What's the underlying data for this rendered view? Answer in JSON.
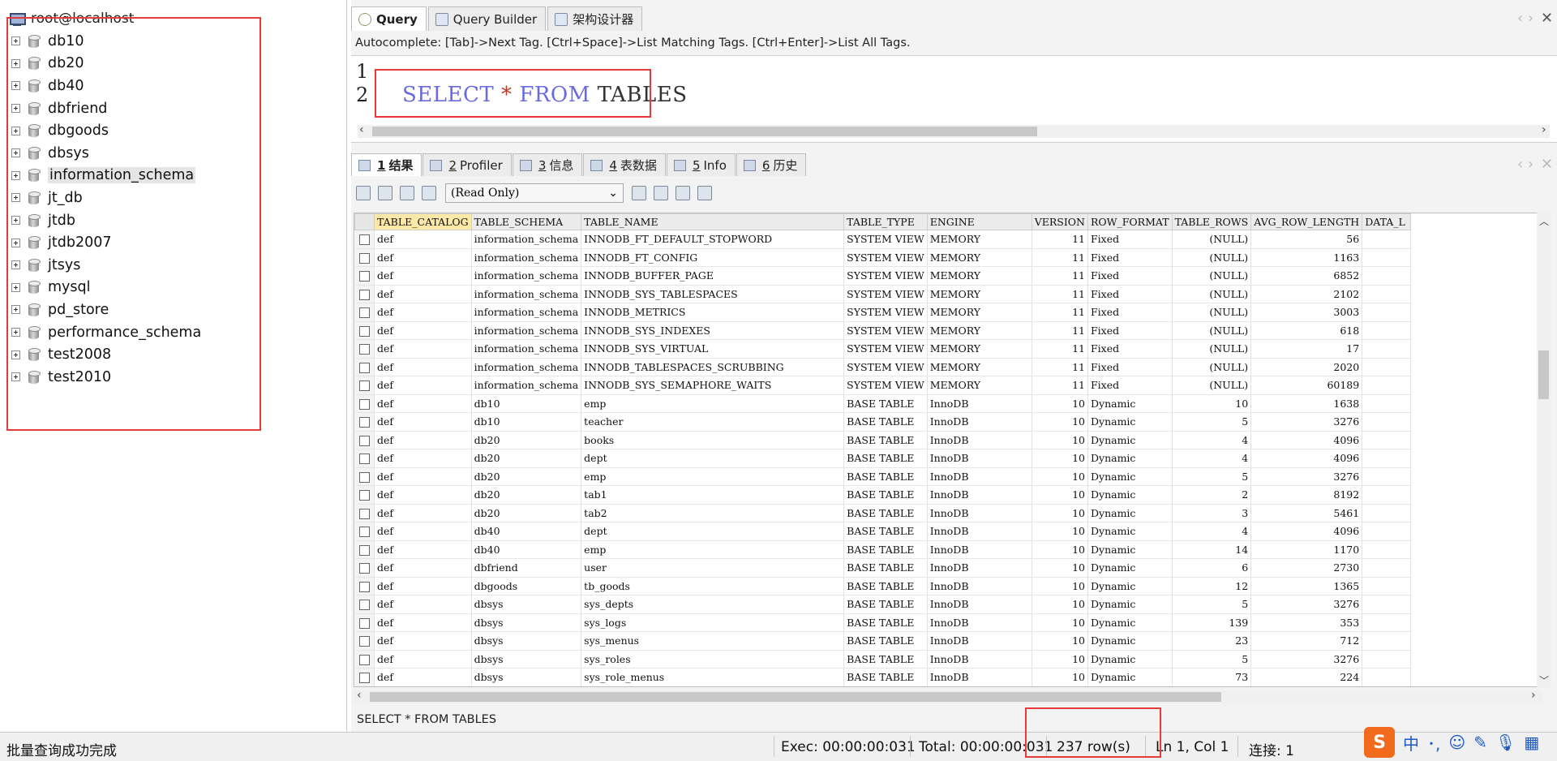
{
  "tree": {
    "host": "root@localhost",
    "items": [
      {
        "label": "db10"
      },
      {
        "label": "db20"
      },
      {
        "label": "db40"
      },
      {
        "label": "dbfriend"
      },
      {
        "label": "dbgoods"
      },
      {
        "label": "dbsys"
      },
      {
        "label": "information_schema",
        "selected": true
      },
      {
        "label": "jt_db"
      },
      {
        "label": "jtdb"
      },
      {
        "label": "jtdb2007"
      },
      {
        "label": "jtsys"
      },
      {
        "label": "mysql"
      },
      {
        "label": "pd_store"
      },
      {
        "label": "performance_schema"
      },
      {
        "label": "test2008"
      },
      {
        "label": "test2010"
      }
    ]
  },
  "editor_tabs": [
    {
      "label": "Query",
      "active": true,
      "icon": "query-icon"
    },
    {
      "label": "Query Builder",
      "active": false,
      "icon": "query-builder-icon"
    },
    {
      "label": "架构设计器",
      "active": false,
      "icon": "schema-designer-icon"
    }
  ],
  "autocomplete_hint": "Autocomplete: [Tab]->Next Tag. [Ctrl+Space]->List Matching Tags. [Ctrl+Enter]->List All Tags.",
  "editor": {
    "line_numbers": [
      "1",
      "2"
    ],
    "sql": {
      "kw1": "SELECT",
      "star": "*",
      "kw2": "FROM",
      "table": "TABLES"
    }
  },
  "result_tabs": [
    {
      "num": "1",
      "label": "结果",
      "active": true,
      "icon": "result-icon"
    },
    {
      "num": "2",
      "label": "Profiler",
      "active": false,
      "icon": "profiler-icon"
    },
    {
      "num": "3",
      "label": "信息",
      "active": false,
      "icon": "info-icon"
    },
    {
      "num": "4",
      "label": "表数据",
      "active": false,
      "icon": "table-data-icon"
    },
    {
      "num": "5",
      "label": "Info",
      "active": false,
      "icon": "info-chart-icon"
    },
    {
      "num": "6",
      "label": "历史",
      "active": false,
      "icon": "history-icon"
    }
  ],
  "result_toolbar": {
    "mode_select": "(Read Only)"
  },
  "grid": {
    "columns": [
      "TABLE_CATALOG",
      "TABLE_SCHEMA",
      "TABLE_NAME",
      "TABLE_TYPE",
      "ENGINE",
      "VERSION",
      "ROW_FORMAT",
      "TABLE_ROWS",
      "AVG_ROW_LENGTH",
      "DATA_L"
    ],
    "rows": [
      [
        "def",
        "information_schema",
        "INNODB_FT_DEFAULT_STOPWORD",
        "SYSTEM VIEW",
        "MEMORY",
        "11",
        "Fixed",
        "(NULL)",
        "56",
        ""
      ],
      [
        "def",
        "information_schema",
        "INNODB_FT_CONFIG",
        "SYSTEM VIEW",
        "MEMORY",
        "11",
        "Fixed",
        "(NULL)",
        "1163",
        ""
      ],
      [
        "def",
        "information_schema",
        "INNODB_BUFFER_PAGE",
        "SYSTEM VIEW",
        "MEMORY",
        "11",
        "Fixed",
        "(NULL)",
        "6852",
        ""
      ],
      [
        "def",
        "information_schema",
        "INNODB_SYS_TABLESPACES",
        "SYSTEM VIEW",
        "MEMORY",
        "11",
        "Fixed",
        "(NULL)",
        "2102",
        ""
      ],
      [
        "def",
        "information_schema",
        "INNODB_METRICS",
        "SYSTEM VIEW",
        "MEMORY",
        "11",
        "Fixed",
        "(NULL)",
        "3003",
        ""
      ],
      [
        "def",
        "information_schema",
        "INNODB_SYS_INDEXES",
        "SYSTEM VIEW",
        "MEMORY",
        "11",
        "Fixed",
        "(NULL)",
        "618",
        ""
      ],
      [
        "def",
        "information_schema",
        "INNODB_SYS_VIRTUAL",
        "SYSTEM VIEW",
        "MEMORY",
        "11",
        "Fixed",
        "(NULL)",
        "17",
        ""
      ],
      [
        "def",
        "information_schema",
        "INNODB_TABLESPACES_SCRUBBING",
        "SYSTEM VIEW",
        "MEMORY",
        "11",
        "Fixed",
        "(NULL)",
        "2020",
        ""
      ],
      [
        "def",
        "information_schema",
        "INNODB_SYS_SEMAPHORE_WAITS",
        "SYSTEM VIEW",
        "MEMORY",
        "11",
        "Fixed",
        "(NULL)",
        "60189",
        ""
      ],
      [
        "def",
        "db10",
        "emp",
        "BASE TABLE",
        "InnoDB",
        "10",
        "Dynamic",
        "10",
        "1638",
        ""
      ],
      [
        "def",
        "db10",
        "teacher",
        "BASE TABLE",
        "InnoDB",
        "10",
        "Dynamic",
        "5",
        "3276",
        ""
      ],
      [
        "def",
        "db20",
        "books",
        "BASE TABLE",
        "InnoDB",
        "10",
        "Dynamic",
        "4",
        "4096",
        ""
      ],
      [
        "def",
        "db20",
        "dept",
        "BASE TABLE",
        "InnoDB",
        "10",
        "Dynamic",
        "4",
        "4096",
        ""
      ],
      [
        "def",
        "db20",
        "emp",
        "BASE TABLE",
        "InnoDB",
        "10",
        "Dynamic",
        "5",
        "3276",
        ""
      ],
      [
        "def",
        "db20",
        "tab1",
        "BASE TABLE",
        "InnoDB",
        "10",
        "Dynamic",
        "2",
        "8192",
        ""
      ],
      [
        "def",
        "db20",
        "tab2",
        "BASE TABLE",
        "InnoDB",
        "10",
        "Dynamic",
        "3",
        "5461",
        ""
      ],
      [
        "def",
        "db40",
        "dept",
        "BASE TABLE",
        "InnoDB",
        "10",
        "Dynamic",
        "4",
        "4096",
        ""
      ],
      [
        "def",
        "db40",
        "emp",
        "BASE TABLE",
        "InnoDB",
        "10",
        "Dynamic",
        "14",
        "1170",
        ""
      ],
      [
        "def",
        "dbfriend",
        "user",
        "BASE TABLE",
        "InnoDB",
        "10",
        "Dynamic",
        "6",
        "2730",
        ""
      ],
      [
        "def",
        "dbgoods",
        "tb_goods",
        "BASE TABLE",
        "InnoDB",
        "10",
        "Dynamic",
        "12",
        "1365",
        ""
      ],
      [
        "def",
        "dbsys",
        "sys_depts",
        "BASE TABLE",
        "InnoDB",
        "10",
        "Dynamic",
        "5",
        "3276",
        ""
      ],
      [
        "def",
        "dbsys",
        "sys_logs",
        "BASE TABLE",
        "InnoDB",
        "10",
        "Dynamic",
        "139",
        "353",
        ""
      ],
      [
        "def",
        "dbsys",
        "sys_menus",
        "BASE TABLE",
        "InnoDB",
        "10",
        "Dynamic",
        "23",
        "712",
        ""
      ],
      [
        "def",
        "dbsys",
        "sys_roles",
        "BASE TABLE",
        "InnoDB",
        "10",
        "Dynamic",
        "5",
        "3276",
        ""
      ],
      [
        "def",
        "dbsys",
        "sys_role_menus",
        "BASE TABLE",
        "InnoDB",
        "10",
        "Dynamic",
        "73",
        "224",
        ""
      ]
    ]
  },
  "sql_echo": "SELECT * FROM TABLES",
  "status": {
    "message": "批量查询成功完成",
    "exec": "Exec: 00:00:00:031",
    "total": "Total: 00:00:00:031",
    "rows": "237 row(s)",
    "cursor": "Ln 1, Col 1",
    "connection": "连接: 1"
  },
  "ime": {
    "logo": "S",
    "mode": "中"
  },
  "colors": {
    "highlight_box": "#e53b3b",
    "keyword": "#6a6ae0",
    "header_first": "#fde8a8"
  }
}
